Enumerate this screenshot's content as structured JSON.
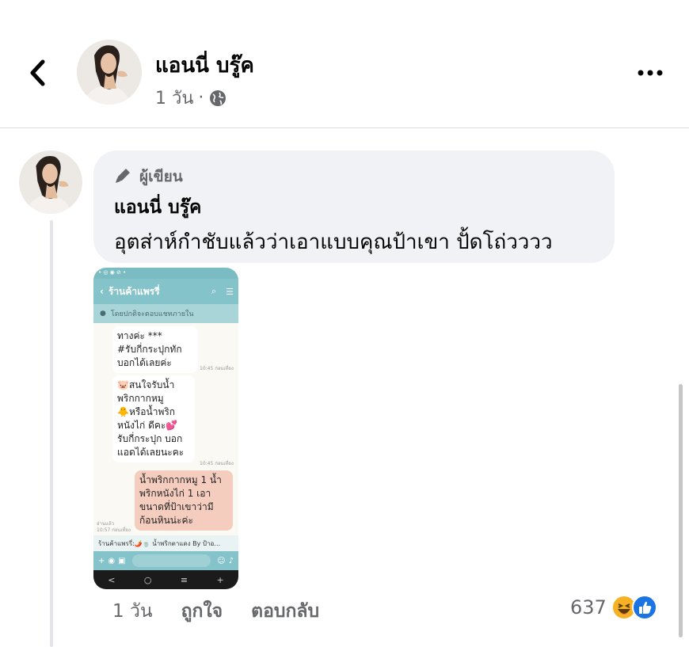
{
  "header": {
    "name": "แอนนี่ บรู๊ค",
    "time": "1 วัน",
    "separator": "·"
  },
  "comment": {
    "author_badge": "ผู้เขียน",
    "author_name": "แอนนี่ บรู๊ค",
    "text": "อุตส่าห์กำชับแล้วว่าเอาแบบคุณป้าเขา ปั้ดโถ่วววว"
  },
  "attachment": {
    "status_bar": "• ◎ ◉ ⊘ •",
    "shop_title": "ร้านค้าแพรรี่",
    "auto_reply_note": "โดยปกติจะตอบแชทภายใน",
    "messages": [
      {
        "text": "ทางค่ะ ***\n#รับกี่กระปุกทัก\nบอกได้เลยค่ะ",
        "time": "10:45 ก่อนเที่ยง"
      },
      {
        "text": "🐷สนใจรับน้ำ\nพริกกากหมู\n🐥หรือน้ำพริก\nหนังไก่ ดีคะ💕\nรับกี่กระปุก บอก\nแอดได้เลยนะคะ",
        "time": "10:45 ก่อนเที่ยง"
      }
    ],
    "outgoing": {
      "text": "น้ำพริกกากหมู 1 น้ำ\nพริกหนังไก่ 1 เอา\nขนาดที่ป้าเขาว่ามี\nก้อนหินน่ะค่ะ",
      "read": "อ่านแล้ว",
      "time": "10:57 ก่อนเที่ยง"
    },
    "preview": "ร้านค้าแพรรี่:🌶️🍵 น้ำพริกตาแดง By ป้าอ…",
    "nav": [
      "<",
      "○",
      "≡",
      "+"
    ]
  },
  "footer": {
    "time": "1 วัน",
    "like": "ถูกใจ",
    "reply": "ตอบกลับ",
    "reaction_count": "637"
  },
  "colors": {
    "bubble": "#f0f2f5",
    "meta_text": "#65676b",
    "like_blue": "#1b74e4",
    "haha_yellow": "#f7b125",
    "shop_teal": "#83c3c9"
  }
}
